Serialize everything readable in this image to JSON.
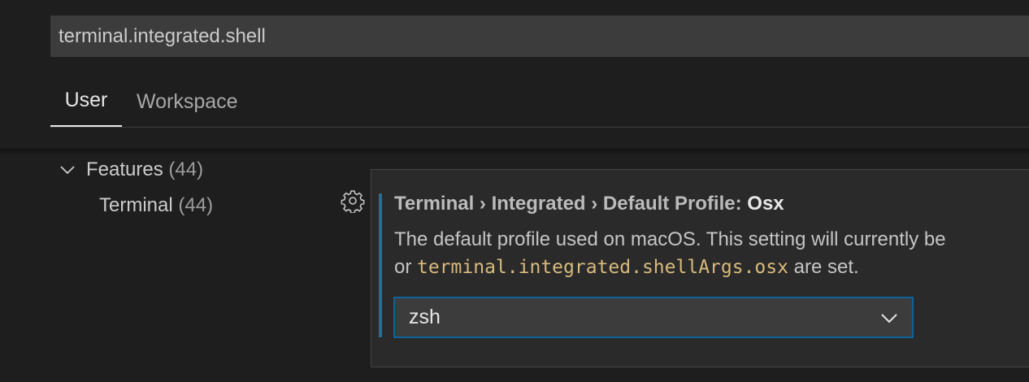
{
  "search": {
    "value": "terminal.integrated.shell"
  },
  "tabs": [
    {
      "label": "User",
      "active": true
    },
    {
      "label": "Workspace",
      "active": false
    }
  ],
  "toc": {
    "features": {
      "label": "Features",
      "count": "(44)",
      "expanded": true,
      "icon": "chevron-down-icon"
    },
    "terminal": {
      "label": "Terminal",
      "count": "(44)"
    }
  },
  "setting": {
    "gear_icon": "gear-icon",
    "title_path": "Terminal › Integrated › Default Profile: ",
    "title_key": "Osx",
    "description_line1": "The default profile used on macOS. This setting will currently be",
    "description_line2_prefix": "or ",
    "description_line2_code": "terminal.integrated.shellArgs.osx",
    "description_line2_suffix": " are set.",
    "dropdown": {
      "selected": "zsh",
      "icon": "chevron-down-icon"
    }
  },
  "colors": {
    "background": "#1e1e1e",
    "input_background": "#3c3c3c",
    "focus_border": "#0e639c",
    "code_text": "#d7ba7d",
    "focus_bar": "#1f6fa1"
  }
}
